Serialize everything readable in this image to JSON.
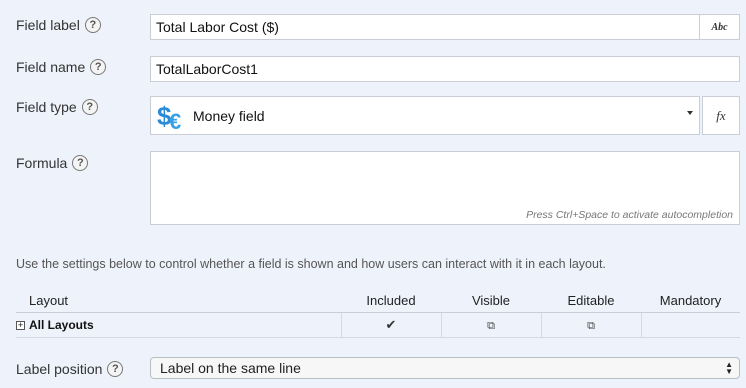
{
  "field_label": {
    "label": "Field label",
    "help": "?",
    "value": "Total Labor Cost ($)",
    "format_button": "Abc"
  },
  "field_name": {
    "label": "Field name",
    "help": "?",
    "value": "TotalLaborCost1"
  },
  "field_type": {
    "label": "Field type",
    "help": "?",
    "selected": "Money field",
    "icon": "money-icon",
    "formula_button": "fx"
  },
  "formula": {
    "label": "Formula",
    "help": "?",
    "value": "",
    "hint": "Press Ctrl+Space to activate autocompletion"
  },
  "info_text": "Use the settings below to control whether a field is shown and how users can interact with it in each layout.",
  "layouts_table": {
    "columns": [
      "Layout",
      "Included",
      "Visible",
      "Editable",
      "Mandatory"
    ],
    "rows": [
      {
        "expand": "+",
        "layout": "All Layouts",
        "included": "✔",
        "visible": "⧉",
        "editable": "⧉",
        "mandatory": ""
      }
    ]
  },
  "label_position": {
    "label": "Label position",
    "help": "?",
    "selected": "Label on the same line"
  },
  "colors": {
    "background": "#eef3fb",
    "icon_blue": "#2a8ad8"
  }
}
